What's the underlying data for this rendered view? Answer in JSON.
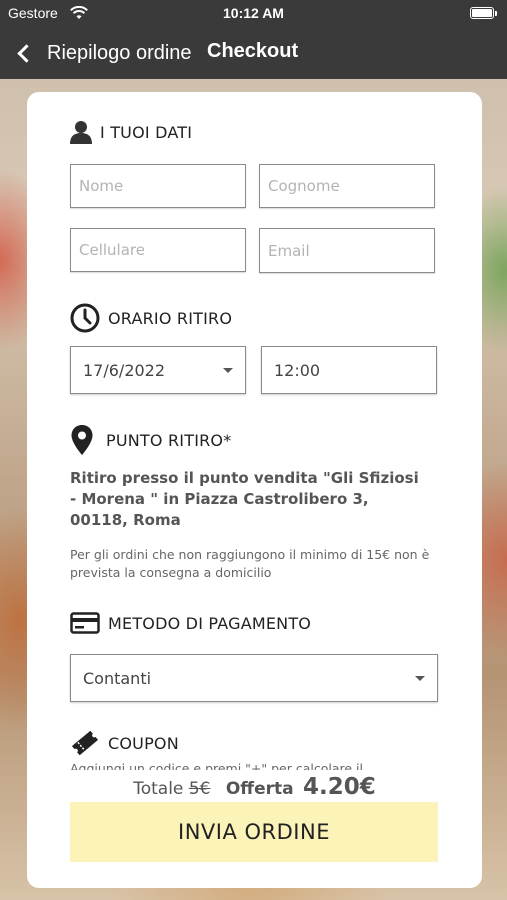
{
  "status_bar": {
    "carrier": "Gestore",
    "time": "10:12 AM"
  },
  "nav": {
    "back_label": "Riepilogo ordine",
    "title": "Checkout"
  },
  "personal": {
    "heading": "I TUOI DATI",
    "first_name_placeholder": "Nome",
    "last_name_placeholder": "Cognome",
    "phone_placeholder": "Cellulare",
    "email_placeholder": "Email"
  },
  "pickup_time": {
    "heading": "ORARIO RITIRO",
    "date": "17/6/2022",
    "time": "12:00"
  },
  "pickup_point": {
    "heading": "PUNTO RITIRO*",
    "address": "Ritiro presso il punto vendita \"Gli Sfiziosi - Morena \" in Piazza Castrolibero 3, 00118, Roma",
    "note": "Per gli ordini che non raggiungono il minimo di 15€ non è prevista la consegna a domicilio"
  },
  "payment": {
    "heading": "METODO DI PAGAMENTO",
    "selected": "Contanti"
  },
  "coupon": {
    "heading": "COUPON",
    "description": "Aggiungi un codice e premi \"+\" per calcolare il"
  },
  "totals": {
    "label": "Totale",
    "original": "5€",
    "offer_label": "Offerta",
    "price": "4.20€"
  },
  "submit_label": "INVIA ORDINE"
}
